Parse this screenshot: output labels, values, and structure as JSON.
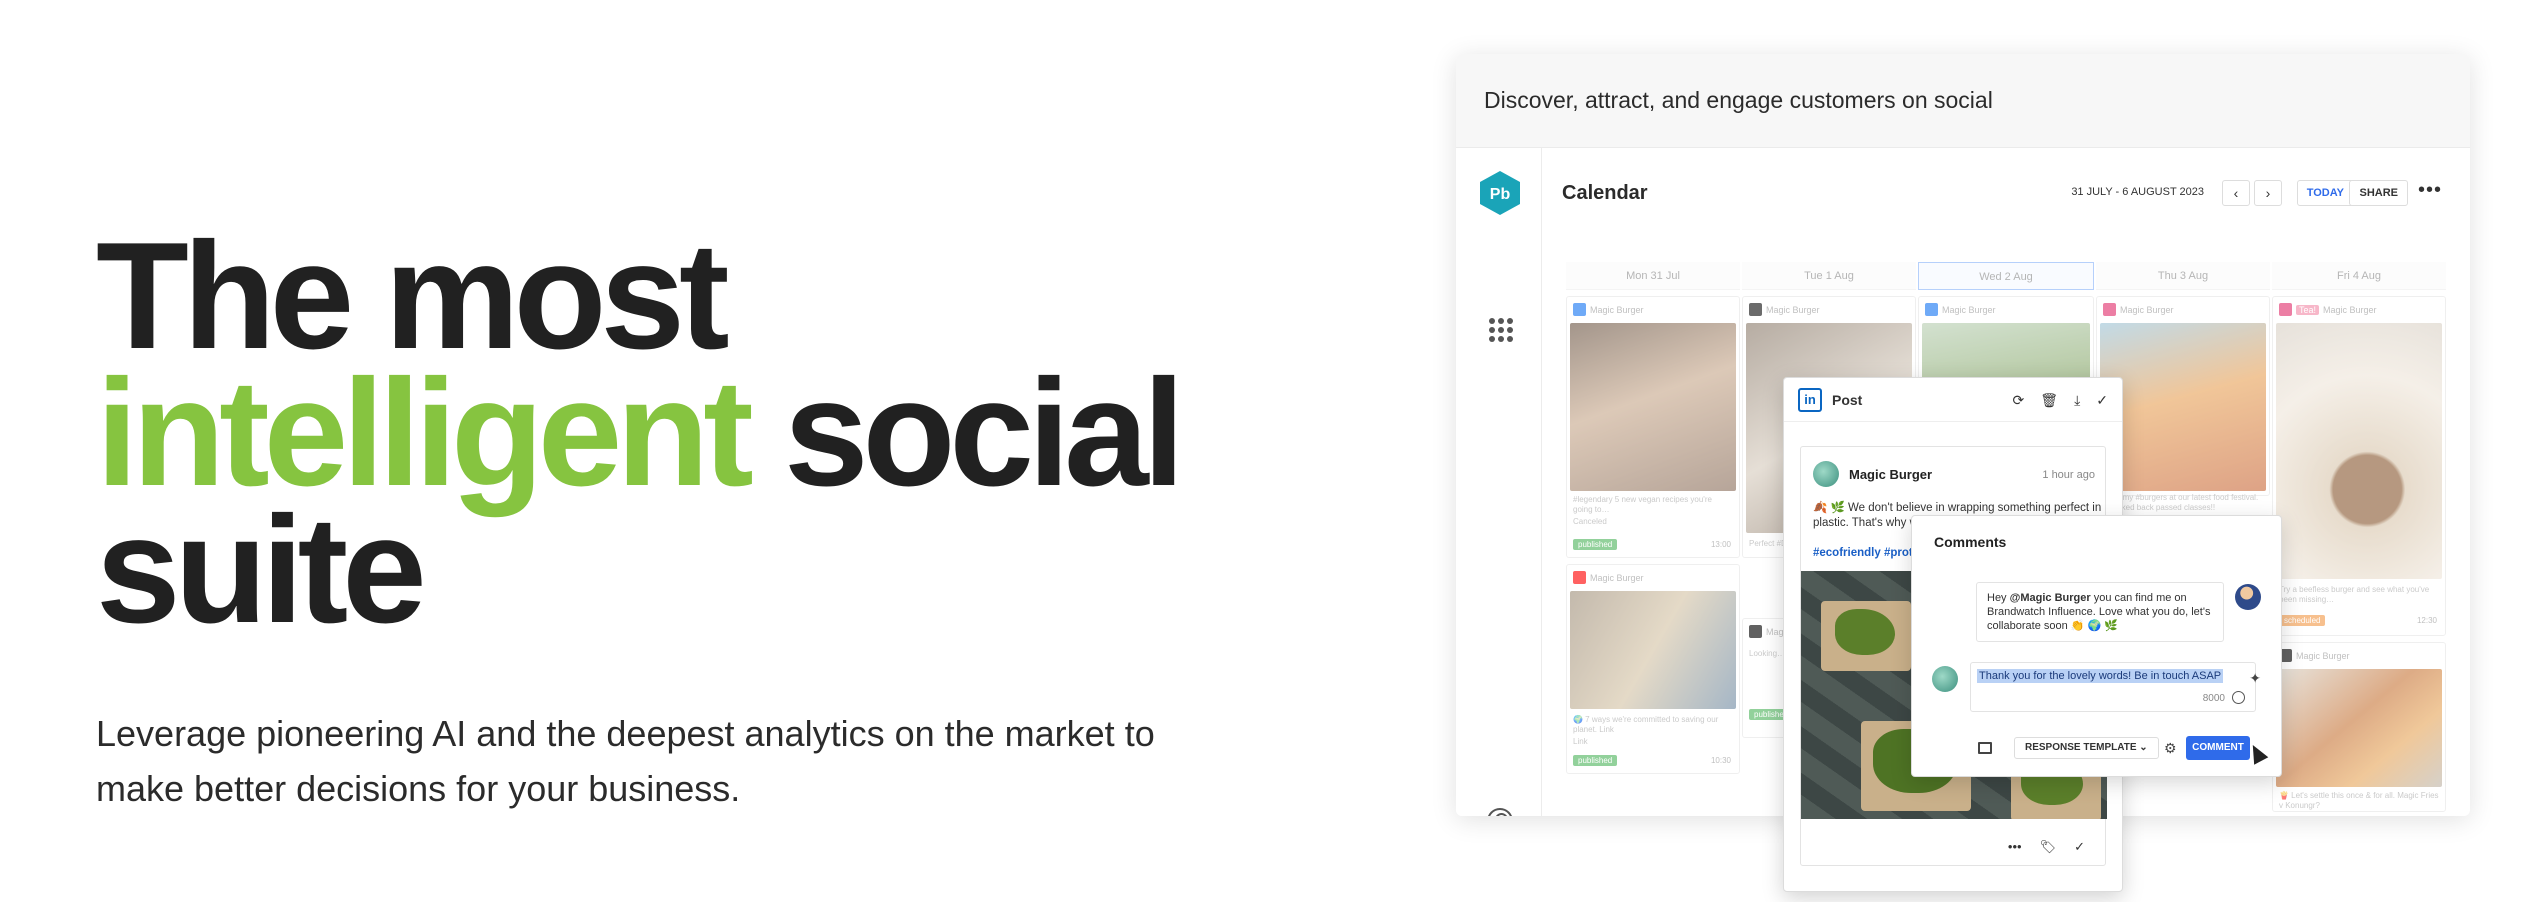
{
  "hero": {
    "line1": "The most",
    "accent": "intelligent",
    "line2_rest": " social",
    "line3": "suite",
    "sub_line1": "Leverage pioneering AI and the deepest analytics on the market to",
    "sub_line2": "make better decisions for your business."
  },
  "frame": {
    "header": "Discover, attract, and engage customers on social",
    "logo": "Pb"
  },
  "calendar": {
    "title": "Calendar",
    "range": "31 JULY - 6 AUGUST 2023",
    "prev": "‹",
    "next": "›",
    "today": "TODAY",
    "share": "SHARE",
    "more": "•••",
    "days": [
      "Mon 31 Jul",
      "Tue 1 Aug",
      "Wed 2 Aug",
      "Thu 3 Aug",
      "Fri 4 Aug"
    ],
    "account": "Magic Burger",
    "cards": [
      {
        "caption": "#legendary 5 new vegan recipes you're going to…",
        "meta": "Canceled",
        "status": "published",
        "time": "13:00"
      },
      {
        "caption": "🌍 7 ways we're committed to saving our planet. Link",
        "meta": "Link",
        "status": "published",
        "time": "10:30"
      },
      {
        "caption": "#yummy #burgers at our latest food festival. Checked back passed classes!!",
        "status": "",
        "time": ""
      },
      {
        "caption": "Try a beefless burger and see what you've been missing…",
        "status": "scheduled",
        "time": "12:30"
      },
      {
        "caption": "🍟 Let's settle this once & for all. Magic Fries v Konungr?",
        "status": "",
        "time": ""
      },
      {
        "caption": "Perfect #DIY",
        "status": "published",
        "time": ""
      },
      {
        "caption": "Looking… #my regular…",
        "status": "published",
        "time": ""
      },
      {
        "caption": "",
        "status": "",
        "time": ""
      }
    ],
    "status_tag": "Tea!"
  },
  "post": {
    "label": "Post",
    "network": "in",
    "author": "Magic Burger",
    "ago": "1 hour ago",
    "text": "🍂 🌿 We don't believe in wrapping something perfect in plastic. That's why we… sustainable packagi…",
    "tags": "#ecofriendly #protec…"
  },
  "comments": {
    "title": "Comments",
    "incoming_pre": "Hey ",
    "incoming_mention": "@Magic Burger",
    "incoming_post": " you can find me on Brandwatch Influence. Love what you do, let's collaborate soon 👏 🌍 🌿",
    "reply": "Thank you for the lovely words! Be in touch ASAP",
    "count": "8000",
    "template": "RESPONSE TEMPLATE",
    "submit": "COMMENT"
  },
  "colors": {
    "accent_green": "#86c440",
    "brand_teal": "#1aa4b8",
    "button_blue": "#2f6bea",
    "published_green": "#4fb55e",
    "scheduled_orange": "#f2994a"
  }
}
